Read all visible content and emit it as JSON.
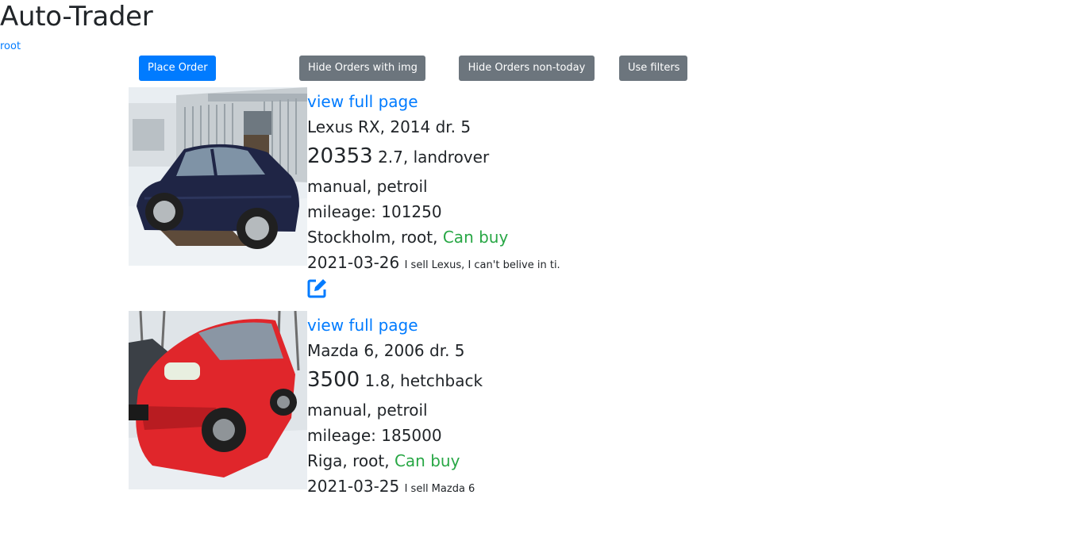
{
  "header": {
    "title": "Auto-Trader",
    "user": "root"
  },
  "toolbar": {
    "place_order": "Place Order",
    "hide_img": "Hide Orders with img",
    "hide_non_today": "Hide Orders non-today",
    "use_filters": "Use filters"
  },
  "colors": {
    "primary": "#007bff",
    "secondary": "#6c757d",
    "success": "#28a745",
    "text": "#212529"
  },
  "orders": [
    {
      "link": "view full page",
      "title": "Lexus RX, 2014 dr. 5",
      "price": "20353",
      "engine_body": "2.7, landrover",
      "transmission_fuel": "manual, petroil",
      "mileage": "mileage: 101250",
      "city_user": "Stockholm, root,",
      "status": "Can buy",
      "date": "2021-03-26",
      "description": "I sell Lexus, I can't belive in ti.",
      "edit_icon": "edit-icon"
    },
    {
      "link": "view full page",
      "title": "Mazda 6, 2006 dr. 5",
      "price": "3500",
      "engine_body": "1.8, hetchback",
      "transmission_fuel": "manual, petroil",
      "mileage": "mileage: 185000",
      "city_user": "Riga, root,",
      "status": "Can buy",
      "date": "2021-03-25",
      "description": "I sell Mazda 6"
    }
  ]
}
